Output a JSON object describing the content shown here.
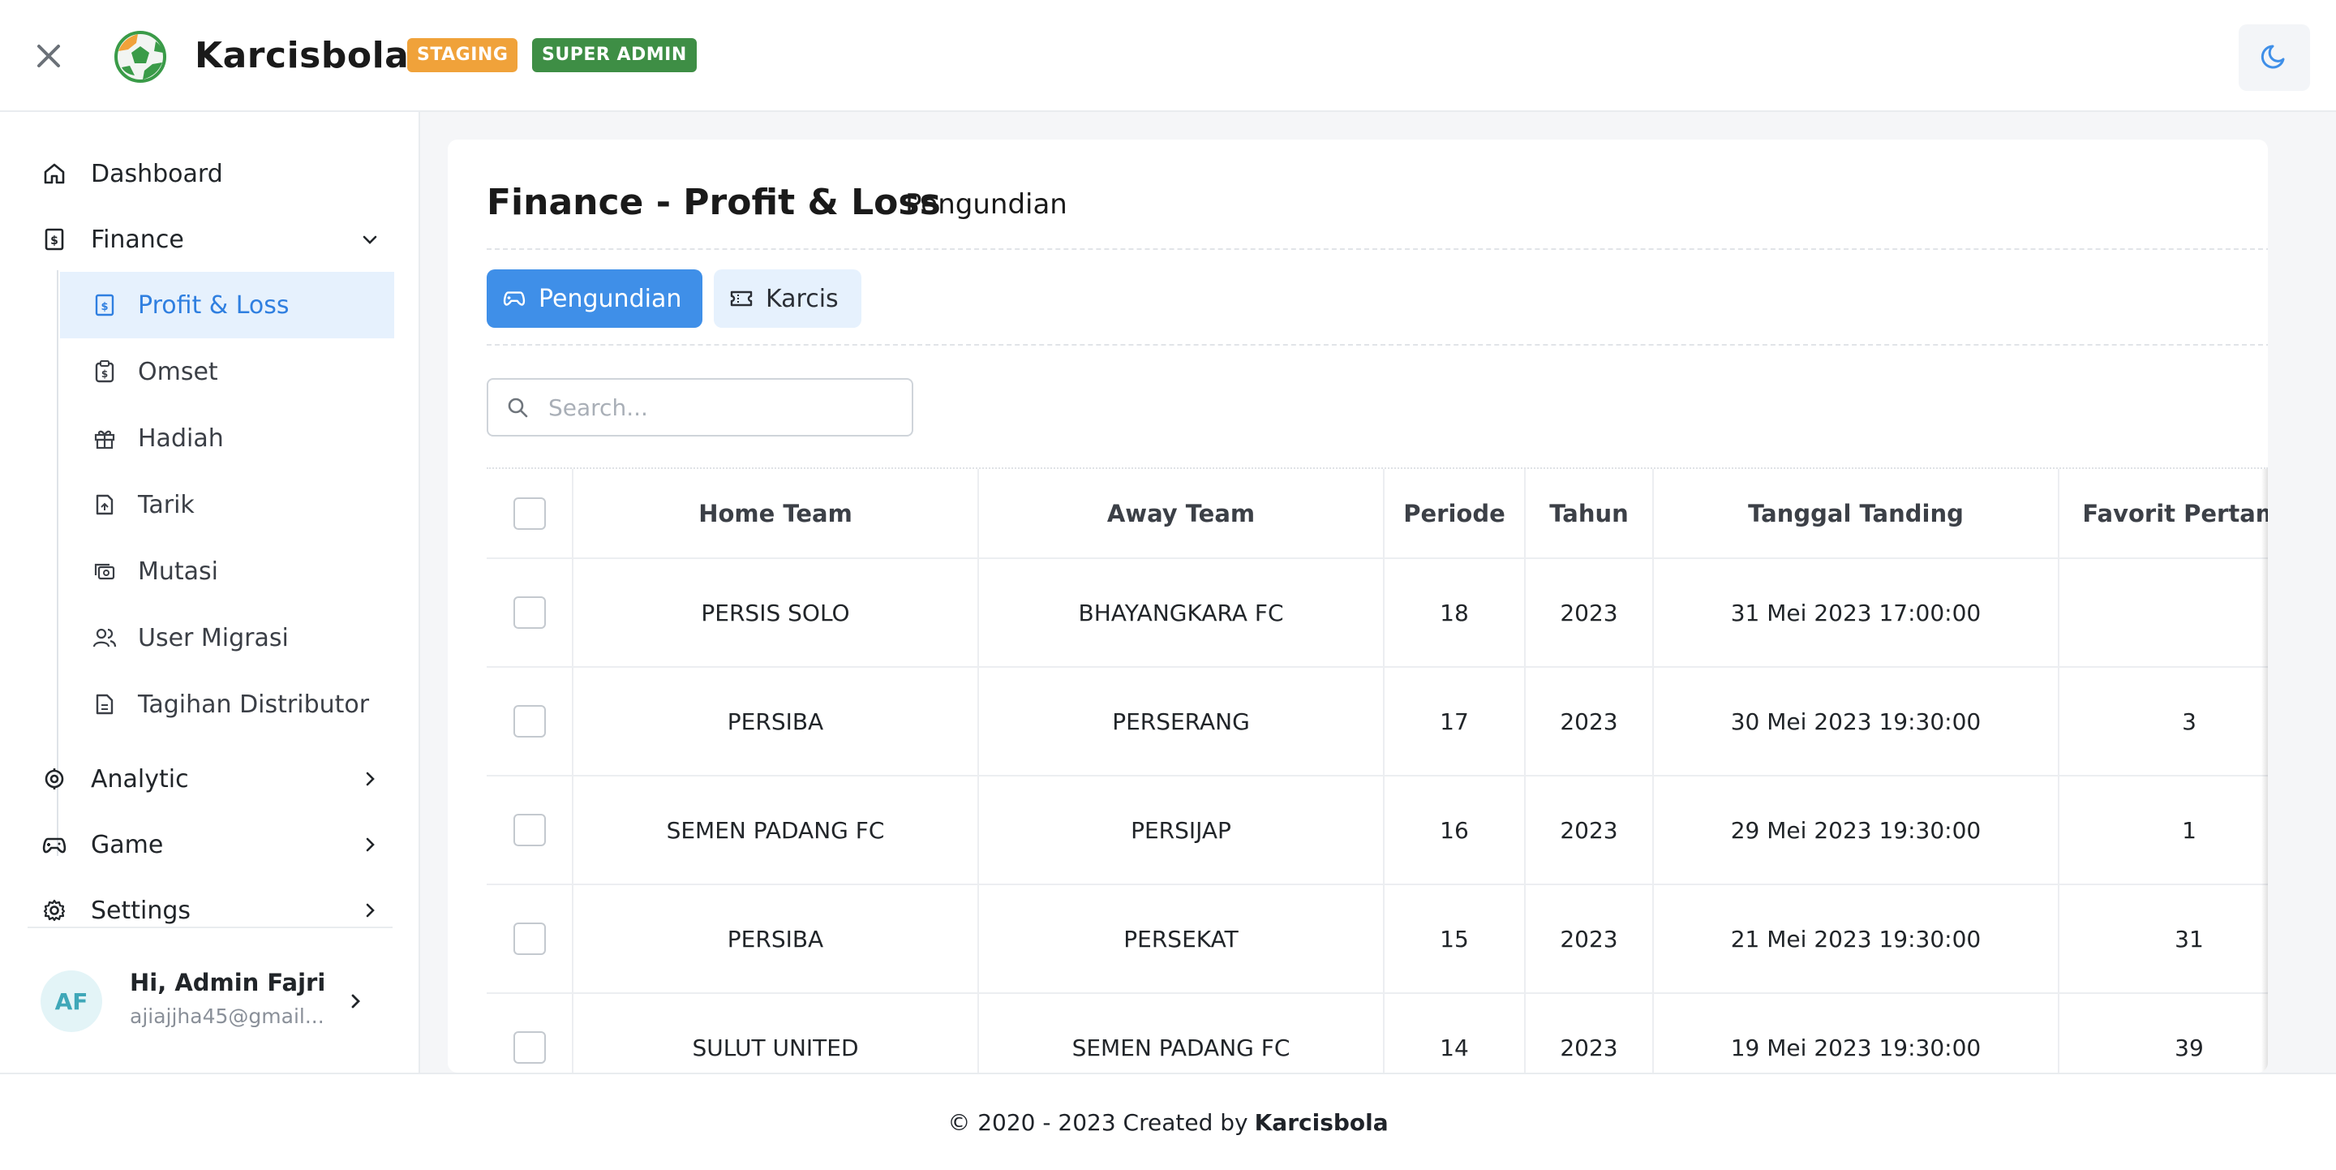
{
  "app": {
    "brand": "Karcisbola",
    "badges": [
      "STAGING",
      "SUPER ADMIN"
    ]
  },
  "sidebar": {
    "items": [
      {
        "label": "Dashboard",
        "icon": "home-icon"
      },
      {
        "label": "Finance",
        "icon": "receipt-icon",
        "expanded": true
      },
      {
        "label": "Analytic",
        "icon": "target-icon"
      },
      {
        "label": "Game",
        "icon": "gamepad-icon"
      },
      {
        "label": "Settings",
        "icon": "gear-icon"
      }
    ],
    "finance_sub": [
      {
        "label": "Profit & Loss",
        "icon": "receipt-icon",
        "active": true
      },
      {
        "label": "Omset",
        "icon": "clipboard-icon"
      },
      {
        "label": "Hadiah",
        "icon": "gift-icon"
      },
      {
        "label": "Tarik",
        "icon": "withdraw-icon"
      },
      {
        "label": "Mutasi",
        "icon": "transfer-icon"
      },
      {
        "label": "User Migrasi",
        "icon": "users-icon"
      },
      {
        "label": "Tagihan Distributor",
        "icon": "document-icon"
      }
    ],
    "user": {
      "initials": "AF",
      "greeting": "Hi, Admin Fajri",
      "email": "ajiajjha45@gmail..."
    }
  },
  "main": {
    "title": "Finance - Profit & Loss",
    "subtitle": "Pengundian",
    "tabs": [
      {
        "label": "Pengundian",
        "icon": "gamepad-icon",
        "active": true
      },
      {
        "label": "Karcis",
        "icon": "ticket-icon",
        "active": false
      }
    ],
    "search_placeholder": "Search...",
    "table": {
      "columns": [
        "Home Team",
        "Away Team",
        "Periode",
        "Tahun",
        "Tanggal Tanding",
        "Favorit Pertama"
      ],
      "rows": [
        [
          "PERSIS SOLO",
          "BHAYANGKARA FC",
          "18",
          "2023",
          "31 Mei 2023 17:00:00",
          ""
        ],
        [
          "PERSIBA",
          "PERSERANG",
          "17",
          "2023",
          "30 Mei 2023 19:30:00",
          "3"
        ],
        [
          "SEMEN PADANG FC",
          "PERSIJAP",
          "16",
          "2023",
          "29 Mei 2023 19:30:00",
          "1"
        ],
        [
          "PERSIBA",
          "PERSEKAT",
          "15",
          "2023",
          "21 Mei 2023 19:30:00",
          "31"
        ],
        [
          "SULUT UNITED",
          "SEMEN PADANG FC",
          "14",
          "2023",
          "19 Mei 2023 19:30:00",
          "39"
        ]
      ]
    }
  },
  "footer": {
    "text": "© 2020 - 2023 Created by",
    "brand": "Karcisbola"
  },
  "colors": {
    "accent": "#3f8fe8",
    "accent_light": "#e6f1fd",
    "staging": "#f0a23a",
    "super_admin": "#3e8e45"
  }
}
